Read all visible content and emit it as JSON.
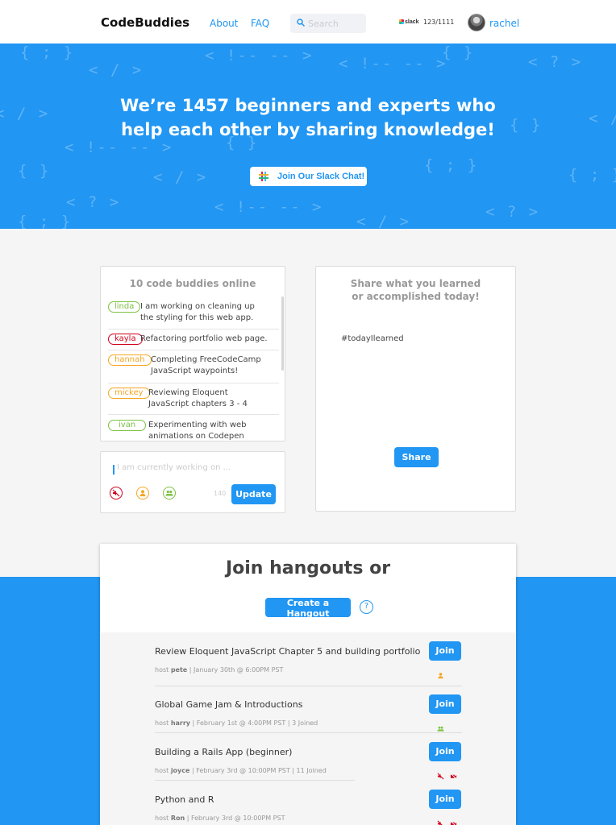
{
  "header": {
    "logo": "CodeBuddies",
    "nav": [
      "About",
      "FAQ"
    ],
    "search_placeholder": "Search",
    "slack_label": "slack",
    "slack_count": "123/1111",
    "username": "rachel"
  },
  "hero": {
    "title_line1": "We’re 1457 beginners and experts who",
    "title_line2": "help each other by sharing knowledge!",
    "slack_button": "Join Our Slack Chat!",
    "background_glyphs": [
      "{ ; }",
      "< / >",
      "< !-- -- >",
      "< ? >",
      "{ }"
    ]
  },
  "online": {
    "title": "10 code buddies online",
    "items": [
      {
        "user": "linda",
        "color": "#7cc242",
        "text": "I am working on cleaning up the styling for this web app."
      },
      {
        "user": "kayla",
        "color": "#d0021b",
        "text": "Refactoring portfolio web page."
      },
      {
        "user": "hannah",
        "color": "#f5a623",
        "text": "Completing FreeCodeCamp JavaScript waypoints!"
      },
      {
        "user": "mickey",
        "color": "#f5a623",
        "text": "Reviewing Eloquent JavaScript chapters 3 - 4"
      },
      {
        "user": "ivan",
        "color": "#7cc242",
        "text": "Experimenting with web animations on Codepen"
      }
    ]
  },
  "compose": {
    "placeholder": "I am currently working on ...",
    "char_count": "140",
    "update_button": "Update",
    "icons": [
      "mute-icon",
      "person-icon",
      "group-icon"
    ]
  },
  "share": {
    "title_line1": "Share what you learned",
    "title_line2": "or accomplished today!",
    "hashtag": "#todayIlearned",
    "button": "Share"
  },
  "hangouts": {
    "title": "Join hangouts or",
    "create_button": "Create a Hangout",
    "help": "?",
    "items": [
      {
        "title": "Review Eloquent JavaScript Chapter 5 and building portfolio",
        "host": "pete",
        "time": "January 30th @ 6:00PM PST",
        "joined": "",
        "icons": [
          "person-icon"
        ],
        "join": "Join"
      },
      {
        "title": "Global Game Jam & Introductions",
        "host": "harry",
        "time": "February 1st @ 4:00PM PST",
        "joined": "3 Joined",
        "icons": [
          "group-icon"
        ],
        "join": "Join"
      },
      {
        "title": "Building a Rails App (beginner)",
        "host": "joyce",
        "time": "February 3rd @ 10:00PM PST",
        "joined": "11 Joined",
        "icons": [
          "mute-icon",
          "no-video-icon"
        ],
        "join": "Join"
      },
      {
        "title": "Python and R",
        "host": "Ron",
        "time": "February 3rd @ 10:00PM PST",
        "joined": "",
        "icons": [
          "mute-icon",
          "no-video-icon"
        ],
        "join": "Join"
      }
    ]
  },
  "colors": {
    "brand_blue": "#2196f3",
    "muted_red": "#d0021b",
    "person_orange": "#f5a623",
    "group_green": "#7cc242"
  }
}
